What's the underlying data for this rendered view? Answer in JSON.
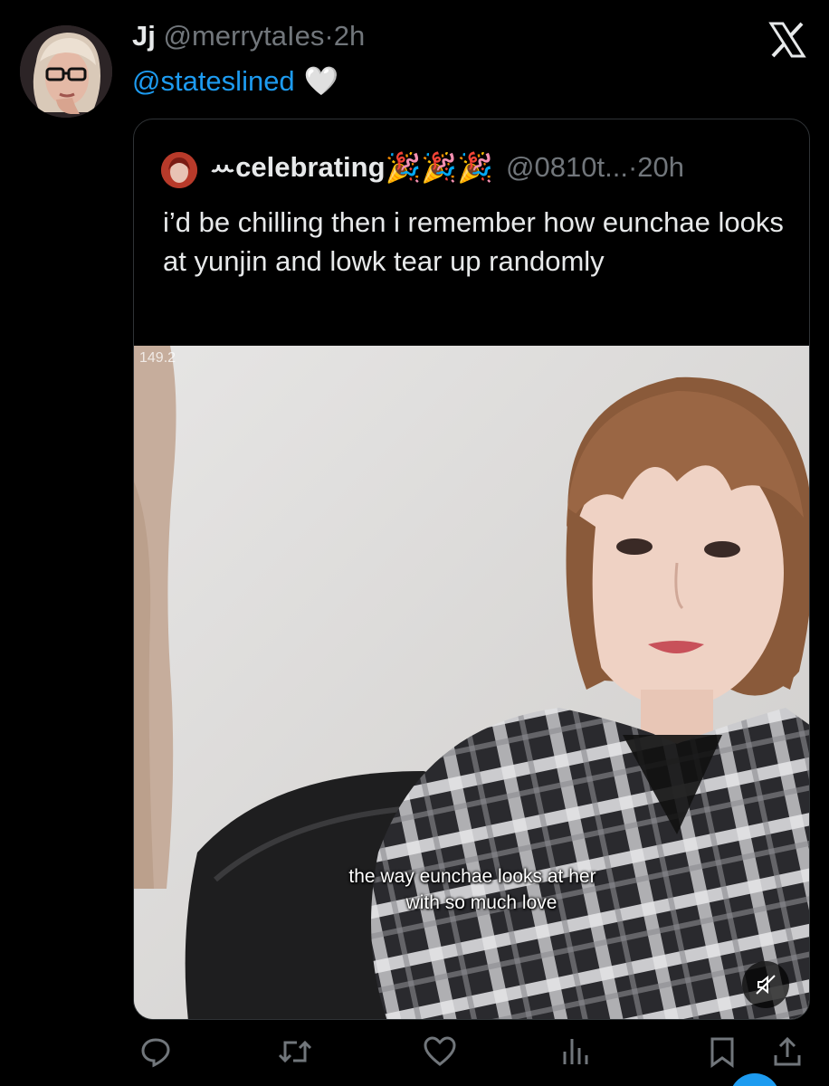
{
  "tweet": {
    "author_name": "Jj",
    "author_handle": "@merrytaIes",
    "separator": "·",
    "time": "2h",
    "reply_mention": "@stateslined",
    "reply_emoji": "🤍",
    "avatar_icon": "user-avatar-photo"
  },
  "quoted_tweet": {
    "author_name": "ꕀcelebrating",
    "author_emoji": "🎉🎉🎉",
    "author_handle": "@0810t...",
    "separator": "·",
    "time": "20h",
    "text": "i’d be chilling then i remember how eunchae looks at yunjin and lowk tear up randomly",
    "media": {
      "overlay_counter": "149.2",
      "subtitle_line1": "the way eunchae looks at her",
      "subtitle_line2": "with so much love",
      "mute_icon": "speaker-muted-icon"
    }
  },
  "actions": {
    "reply_icon": "reply-icon",
    "retweet_icon": "retweet-icon",
    "like_icon": "heart-icon",
    "views_icon": "views-icon",
    "bookmark_icon": "bookmark-icon",
    "share_icon": "share-icon"
  },
  "close_icon": "x-close-icon",
  "colors": {
    "background": "#000000",
    "text_primary": "#e7e9ea",
    "text_secondary": "#71767b",
    "accent": "#1d9bf0",
    "border": "#2f3336"
  }
}
